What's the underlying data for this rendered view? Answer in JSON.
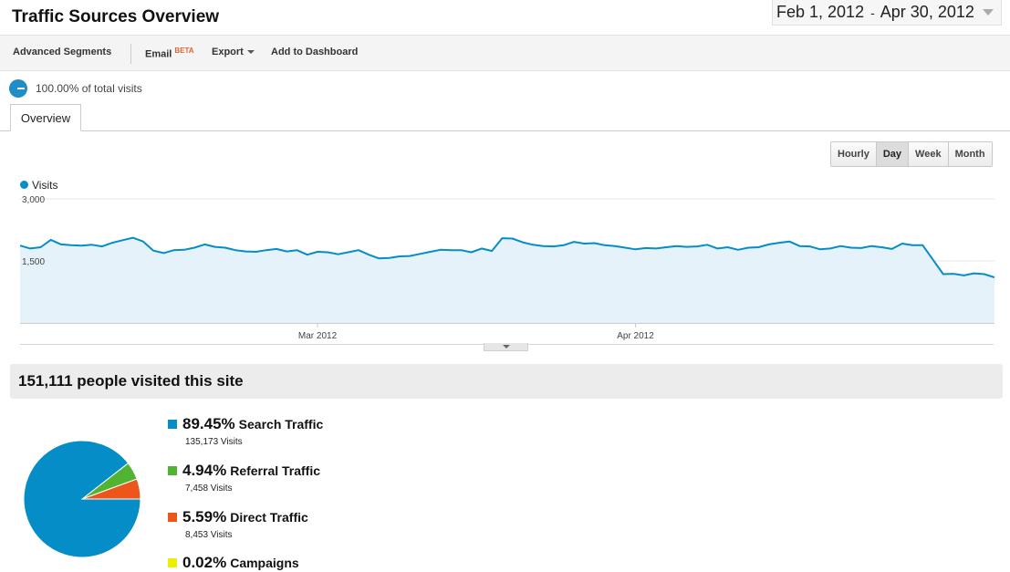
{
  "header": {
    "title": "Traffic Sources Overview",
    "date_start": "Feb 1, 2012",
    "date_sep": "-",
    "date_end": "Apr 30, 2012"
  },
  "toolbar": {
    "advanced_segments": "Advanced Segments",
    "email": "Email",
    "email_badge": "BETA",
    "export": "Export",
    "add_to_dashboard": "Add to Dashboard"
  },
  "segment": {
    "text": "100.00% of total visits"
  },
  "tabs": [
    {
      "label": "Overview"
    }
  ],
  "period_buttons": [
    {
      "label": "Hourly",
      "active": false
    },
    {
      "label": "Day",
      "active": true
    },
    {
      "label": "Week",
      "active": false
    },
    {
      "label": "Month",
      "active": false
    }
  ],
  "chart_data": {
    "type": "area",
    "series": [
      {
        "name": "Visits",
        "values": [
          1870,
          1800,
          1830,
          2010,
          1900,
          1880,
          1870,
          1890,
          1850,
          1940,
          2000,
          2060,
          1970,
          1750,
          1690,
          1760,
          1770,
          1820,
          1900,
          1840,
          1820,
          1760,
          1730,
          1720,
          1760,
          1790,
          1730,
          1760,
          1650,
          1720,
          1710,
          1660,
          1710,
          1760,
          1650,
          1560,
          1570,
          1610,
          1620,
          1670,
          1720,
          1770,
          1760,
          1760,
          1710,
          1800,
          1740,
          2050,
          2040,
          1950,
          1890,
          1860,
          1850,
          1880,
          1960,
          1920,
          1930,
          1880,
          1860,
          1820,
          1780,
          1810,
          1800,
          1830,
          1860,
          1840,
          1850,
          1890,
          1800,
          1830,
          1770,
          1820,
          1830,
          1900,
          1940,
          1970,
          1860,
          1850,
          1780,
          1800,
          1860,
          1820,
          1810,
          1860,
          1830,
          1790,
          1920,
          1880,
          1880,
          1530,
          1180,
          1190,
          1150,
          1200,
          1180,
          1100
        ]
      }
    ],
    "x_tick_labels": [
      "Mar 2012",
      "Apr 2012"
    ],
    "y_tick_labels": [
      "3,000",
      "1,500"
    ],
    "ylim": [
      0,
      3000
    ],
    "grid": true,
    "color": "#058dc7",
    "fill": "#e6f2f9"
  },
  "summary": {
    "text": "151,111 people visited this site"
  },
  "sources": [
    {
      "pct": "89.45%",
      "name": "Search Traffic",
      "visits": "135,173 Visits",
      "color": "#058dc7",
      "share": 0.8945
    },
    {
      "pct": "4.94%",
      "name": "Referral Traffic",
      "visits": "7,458 Visits",
      "color": "#50b432",
      "share": 0.0494
    },
    {
      "pct": "5.59%",
      "name": "Direct Traffic",
      "visits": "8,453 Visits",
      "color": "#ed561b",
      "share": 0.0559
    },
    {
      "pct": "0.02%",
      "name": "Campaigns",
      "visits": "",
      "color": "#edef00",
      "share": 0.0002
    }
  ]
}
